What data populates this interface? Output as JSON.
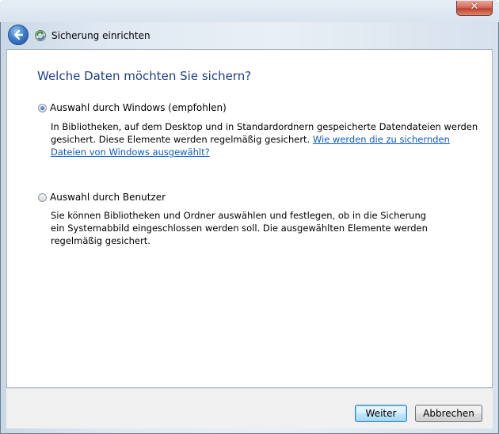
{
  "window": {
    "close_glyph": "✕"
  },
  "nav": {
    "title": "Sicherung einrichten",
    "back_icon": "back-arrow-icon",
    "app_icon": "backup-icon"
  },
  "main": {
    "heading": "Welche Daten möchten Sie sichern?",
    "options": [
      {
        "label": "Auswahl durch Windows (empfohlen)",
        "selected": true,
        "desc": "In Bibliotheken, auf dem Desktop und in Standardordnern gespeicherte Datendateien werden gesichert. Diese Elemente werden regelmäßig gesichert.",
        "link": "Wie werden die zu sichernden Dateien von Windows ausgewählt?"
      },
      {
        "label": "Auswahl durch Benutzer",
        "selected": false,
        "desc": "Sie können Bibliotheken und Ordner auswählen und festlegen, ob in die Sicherung ein Systemabbild eingeschlossen werden soll. Die ausgewählten Elemente werden regelmäßig gesichert."
      }
    ]
  },
  "footer": {
    "next_label": "Weiter",
    "cancel_label": "Abbrechen"
  },
  "colors": {
    "heading": "#1e3f88",
    "link": "#0b5bc4"
  }
}
